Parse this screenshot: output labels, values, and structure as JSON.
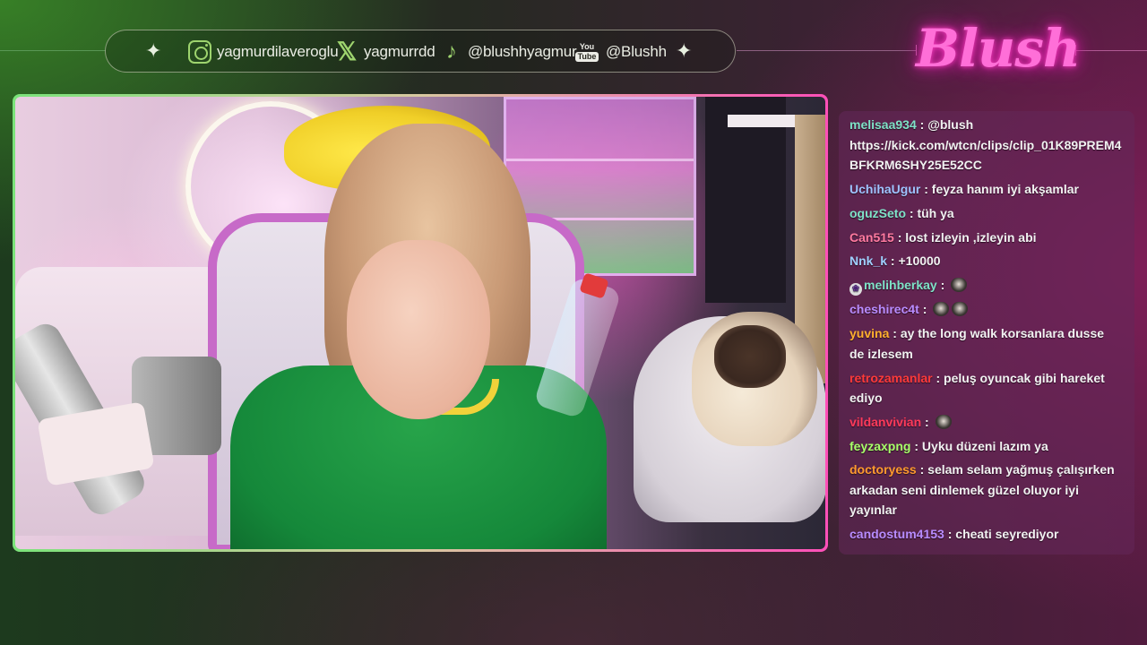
{
  "socials": [
    {
      "icon": "instagram-icon",
      "handle": "yagmurdilaveroglu"
    },
    {
      "icon": "x-icon",
      "handle": "yagmurrdd"
    },
    {
      "icon": "tiktok-icon",
      "handle": "@blushhyagmur"
    },
    {
      "icon": "youtube-icon",
      "handle": "@Blushh"
    }
  ],
  "youtube_icon_text": {
    "top": "You",
    "bottom": "Tube"
  },
  "logo": "Blush",
  "chat": [
    {
      "user": "melisaa934",
      "color": "#7fe3c8",
      "text": "@blush https://kick.com/wtcn/clips/clip_01K89PREM4BFKRM6SHY25E52CC",
      "emotes": 0,
      "badge": false
    },
    {
      "user": "UchihaUgur",
      "color": "#9fc3ff",
      "text": "feyza hanım iyi akşamlar",
      "emotes": 0,
      "badge": false
    },
    {
      "user": "oguzSeto",
      "color": "#7fe3c8",
      "text": "tüh ya",
      "emotes": 0,
      "badge": false
    },
    {
      "user": "Can515",
      "color": "#ff7aa0",
      "text": "lost izleyin ,izleyin abi",
      "emotes": 0,
      "badge": false
    },
    {
      "user": "Nnk_k",
      "color": "#9fd0ff",
      "text": "+10000",
      "emotes": 0,
      "badge": false
    },
    {
      "user": "melihberkay",
      "color": "#7fe3c8",
      "text": "",
      "emotes": 1,
      "badge": true
    },
    {
      "user": "cheshirec4t",
      "color": "#b88cff",
      "text": "",
      "emotes": 2,
      "badge": false
    },
    {
      "user": "yuvina",
      "color": "#ffb02e",
      "text": "ay the long walk korsanlara dusse de izlesem",
      "emotes": 0,
      "badge": false
    },
    {
      "user": "retrozamanlar",
      "color": "#ff3a3a",
      "text": "peluş oyuncak gibi hareket ediyo",
      "emotes": 0,
      "badge": false
    },
    {
      "user": "vildanvivian",
      "color": "#ff3a5a",
      "text": "",
      "emotes": 1,
      "badge": false
    },
    {
      "user": "feyzaxpng",
      "color": "#a8ff6a",
      "text": "Uyku düzeni lazım ya",
      "emotes": 0,
      "badge": false
    },
    {
      "user": "doctoryess",
      "color": "#ff9a2e",
      "text": "selam selam yağmuş çalışırken arkadan seni dinlemek güzel oluyor iyi yayınlar",
      "emotes": 0,
      "badge": false
    },
    {
      "user": "candostum4153",
      "color": "#b88cff",
      "text": "cheati seyrediyor",
      "emotes": 0,
      "badge": false
    }
  ]
}
